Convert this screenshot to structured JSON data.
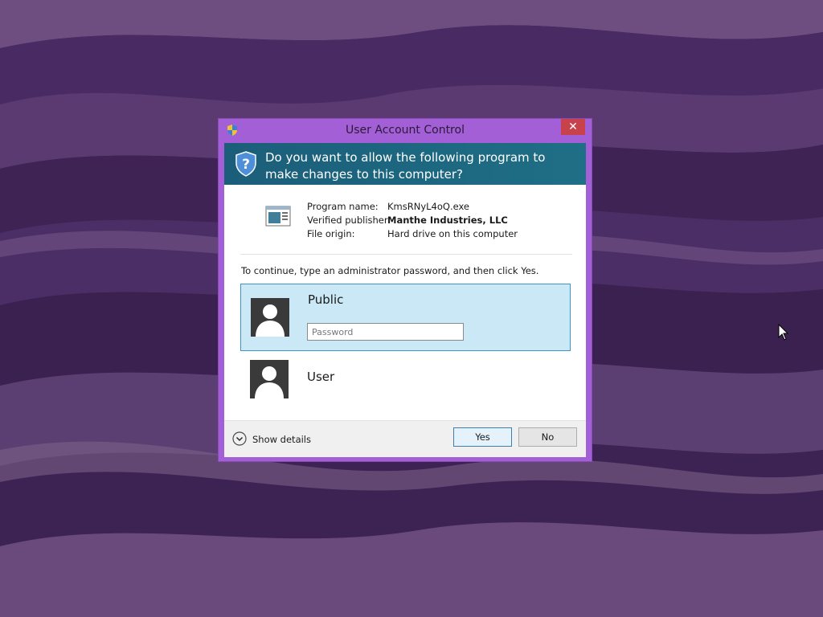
{
  "window": {
    "title": "User Account Control",
    "close_glyph": "✕"
  },
  "header": {
    "question": "Do you want to allow the following program to make changes to this computer?",
    "icon": "uac-shield-question-icon"
  },
  "program": {
    "name_label": "Program name:",
    "name_value": "KmsRNyL4oQ.exe",
    "publisher_label": "Verified publisher:",
    "publisher_value": "Manthe Industries, LLC",
    "origin_label": "File origin:",
    "origin_value": "Hard drive on this computer",
    "icon": "application-window-icon"
  },
  "instruction": "To continue, type an administrator password, and then click Yes.",
  "accounts": [
    {
      "name": "Public",
      "selected": true,
      "password_placeholder": "Password",
      "password_value": ""
    },
    {
      "name": "User",
      "selected": false
    }
  ],
  "footer": {
    "details_label": "Show details",
    "yes_label": "Yes",
    "no_label": "No"
  },
  "colors": {
    "window_frame": "#a35fd6",
    "header_band": "#1d6680",
    "selected_account_bg": "#cbe8f6",
    "selected_account_border": "#3c94c7",
    "close_button": "#c7424b"
  }
}
